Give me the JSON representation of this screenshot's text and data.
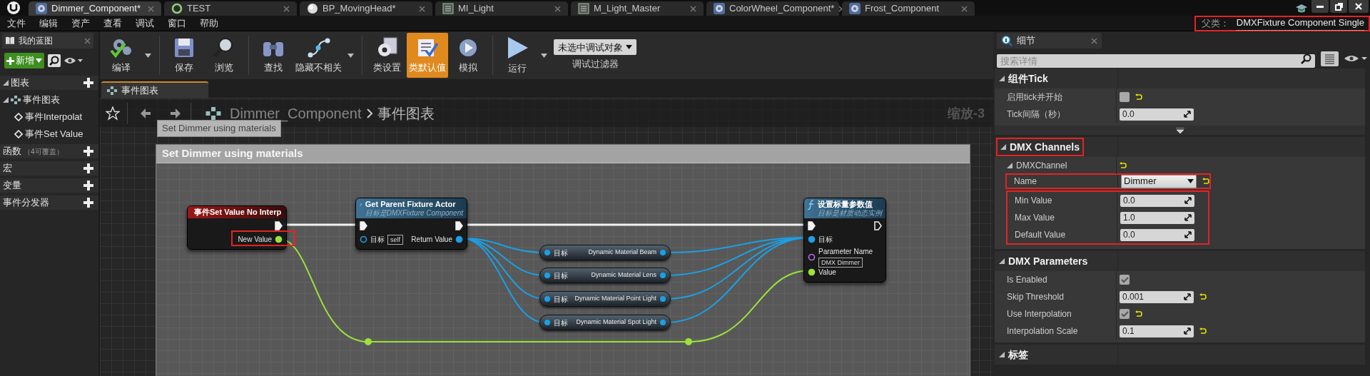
{
  "tabs": [
    {
      "label": "Dimmer_Component*",
      "kind": "component",
      "selected": true
    },
    {
      "label": "TEST",
      "kind": "level",
      "selected": false
    },
    {
      "label": "BP_MovingHead*",
      "kind": "blueprint",
      "selected": false
    },
    {
      "label": "MI_Light",
      "kind": "material",
      "selected": false
    },
    {
      "label": "M_Light_Master",
      "kind": "material",
      "selected": false
    },
    {
      "label": "ColorWheel_Component*",
      "kind": "component",
      "selected": false
    },
    {
      "label": "Frost_Component",
      "kind": "component",
      "selected": false
    }
  ],
  "menu": [
    "文件",
    "编辑",
    "资产",
    "查看",
    "调试",
    "窗口",
    "帮助"
  ],
  "parent_class": {
    "label": "父类：",
    "value": "DMXFixture Component Single",
    "highlighted": true
  },
  "my_blueprint": {
    "tab": "我的蓝图",
    "add_button": "新增",
    "tree": [
      {
        "label": "图表",
        "kind": "category",
        "children": [
          {
            "label": "事件图表",
            "kind": "graph",
            "children": [
              {
                "label": "事件Interpolat",
                "kind": "event"
              },
              {
                "label": "事件Set Value",
                "kind": "event"
              }
            ]
          }
        ]
      },
      {
        "label": "函数",
        "note": "（4可覆盖）",
        "kind": "category"
      },
      {
        "label": "宏",
        "kind": "category"
      },
      {
        "label": "变量",
        "kind": "category"
      },
      {
        "label": "事件分发器",
        "kind": "category"
      }
    ]
  },
  "toolbar": {
    "groups": [
      [
        {
          "label": "编译",
          "kind": "compile",
          "dropdown": true,
          "active": false
        }
      ],
      [
        {
          "label": "保存",
          "kind": "save",
          "dropdown": false,
          "active": false
        },
        {
          "label": "浏览",
          "kind": "browse",
          "dropdown": false,
          "active": false
        }
      ],
      [
        {
          "label": "查找",
          "kind": "find",
          "dropdown": false,
          "active": false
        },
        {
          "label": "隐藏不相关",
          "kind": "hide",
          "dropdown": true,
          "active": false
        }
      ],
      [
        {
          "label": "类设置",
          "kind": "settings",
          "dropdown": false,
          "active": false
        },
        {
          "label": "类默认值",
          "kind": "defaults",
          "dropdown": false,
          "active": true
        },
        {
          "label": "模拟",
          "kind": "simulate",
          "dropdown": false,
          "active": false
        }
      ],
      [
        {
          "label": "运行",
          "kind": "play",
          "dropdown": true,
          "active": false
        }
      ]
    ],
    "debug_filter": {
      "value": "未选中调试对象",
      "label": "调试过滤器"
    }
  },
  "graph": {
    "tab": "事件图表",
    "breadcrumb": [
      "Dimmer_Component",
      "事件图表"
    ],
    "zoom": "缩放-3",
    "tooltip": "Set Dimmer using materials",
    "comment": "Set Dimmer using materials",
    "nodes": [
      {
        "kind": "event",
        "title": "事件Set Value No Interp",
        "outputs": [
          {
            "kind": "exec",
            "connected": true
          },
          {
            "kind": "float",
            "label": "New Value",
            "connected": true,
            "highlighted": true
          }
        ]
      },
      {
        "kind": "function",
        "title": "Get Parent Fixture Actor",
        "subtitle": "目标是DMXFixture Component",
        "inputs": [
          {
            "kind": "exec",
            "connected": true
          },
          {
            "kind": "object",
            "label": "目标",
            "default": "self",
            "connected": false
          }
        ],
        "outputs": [
          {
            "kind": "exec",
            "connected": true
          },
          {
            "kind": "object",
            "label": "Return Value",
            "connected": true
          }
        ]
      },
      {
        "kind": "getter",
        "target": "目标",
        "label": "Dynamic Material Beam"
      },
      {
        "kind": "getter",
        "target": "目标",
        "label": "Dynamic Material Lens"
      },
      {
        "kind": "getter",
        "target": "目标",
        "label": "Dynamic Material Point Light"
      },
      {
        "kind": "getter",
        "target": "目标",
        "label": "Dynamic Material Spot Light"
      },
      {
        "kind": "function",
        "title": "设置标量参数值",
        "subtitle": "目标是材质动态实例",
        "inputs": [
          {
            "kind": "exec",
            "connected": true
          },
          {
            "kind": "object",
            "label": "目标",
            "connected": true
          },
          {
            "kind": "name",
            "label": "Parameter Name",
            "default": "DMX Dimmer",
            "connected": false
          },
          {
            "kind": "float",
            "label": "Value",
            "connected": true
          }
        ],
        "outputs": [
          {
            "kind": "exec",
            "connected": false
          }
        ]
      }
    ]
  },
  "details": {
    "tab": "细节",
    "search": {
      "placeholder": "搜索详情"
    },
    "sections": [
      {
        "title": "组件Tick",
        "highlighted": false,
        "more": true,
        "rows": [
          {
            "kind": "checkbox",
            "label": "启用tick并开始",
            "checked": false,
            "reset": true
          },
          {
            "kind": "number",
            "label": "Tick间隔（秒）",
            "value": "0.0",
            "reset": false
          }
        ]
      },
      {
        "title": "DMX Channels",
        "highlighted": true,
        "more": false,
        "rows": [
          {
            "kind": "group",
            "label": "DMXChannel",
            "reset": true,
            "children": [
              {
                "kind": "dropdown",
                "label": "Name",
                "value": "Dimmer",
                "reset": true,
                "highlighted": true
              },
              {
                "kind": "annotation",
                "children": [
                  {
                    "kind": "number",
                    "label": "Min Value",
                    "value": "0.0",
                    "reset": false
                  },
                  {
                    "kind": "number",
                    "label": "Max Value",
                    "value": "1.0",
                    "reset": false
                  },
                  {
                    "kind": "number",
                    "label": "Default Value",
                    "value": "0.0",
                    "reset": false
                  }
                ]
              }
            ]
          }
        ]
      },
      {
        "title": "DMX Parameters",
        "highlighted": false,
        "more": false,
        "rows": [
          {
            "kind": "checkbox",
            "label": "Is Enabled",
            "checked": true,
            "reset": false
          },
          {
            "kind": "number",
            "label": "Skip Threshold",
            "value": "0.001",
            "reset": true
          },
          {
            "kind": "checkbox",
            "label": "Use Interpolation",
            "checked": true,
            "reset": true
          },
          {
            "kind": "number",
            "label": "Interpolation Scale",
            "value": "0.1",
            "reset": true
          }
        ]
      },
      {
        "title": "标签",
        "highlighted": false,
        "more": false
      }
    ]
  }
}
